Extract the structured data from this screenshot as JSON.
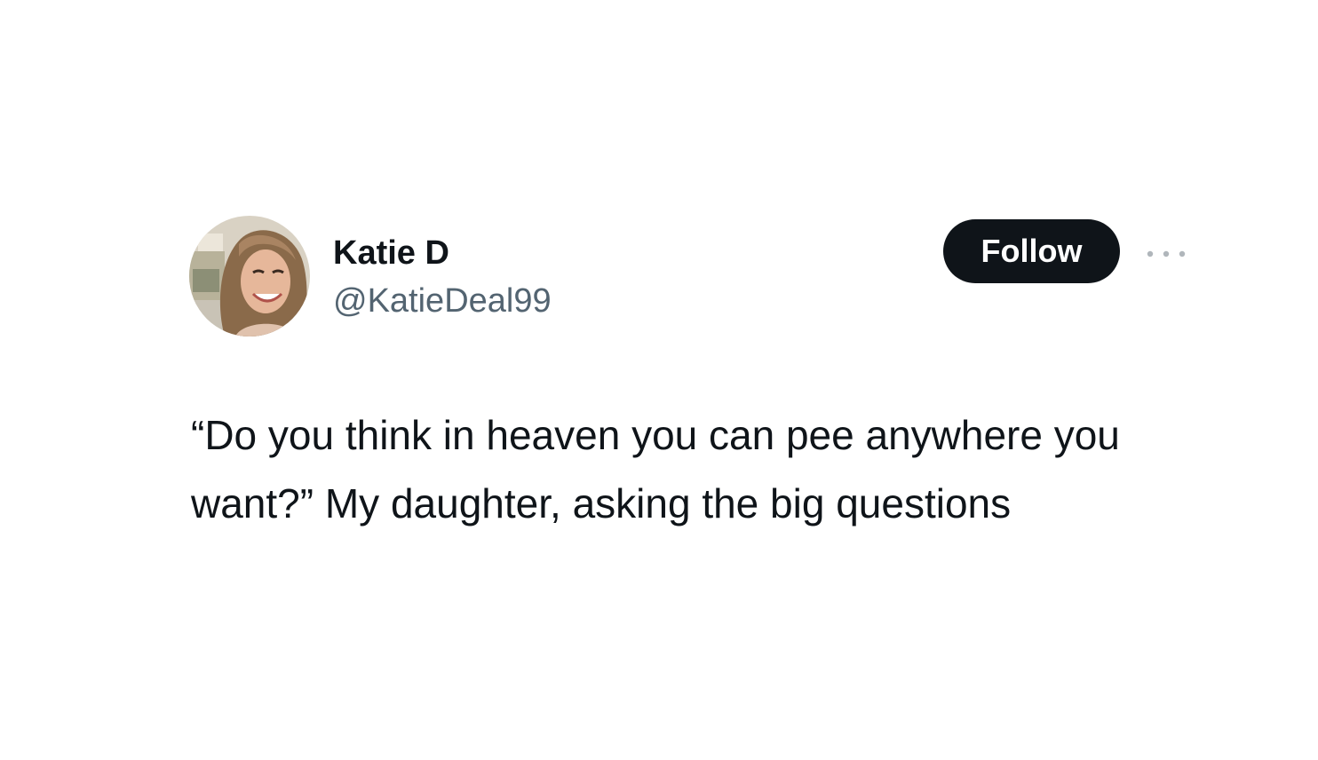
{
  "tweet": {
    "author": {
      "display_name": "Katie D",
      "handle": "@KatieDeal99",
      "avatar_icon": "avatar-photo"
    },
    "follow_label": "Follow",
    "more_icon": "more-horizontal-icon",
    "text": "“Do you think in heaven you can pee anywhere you want?” My daughter, asking the big questions"
  },
  "colors": {
    "text_primary": "#0f1419",
    "text_secondary": "#536471",
    "follow_bg": "#0f1419",
    "follow_text": "#ffffff",
    "background": "#ffffff"
  }
}
